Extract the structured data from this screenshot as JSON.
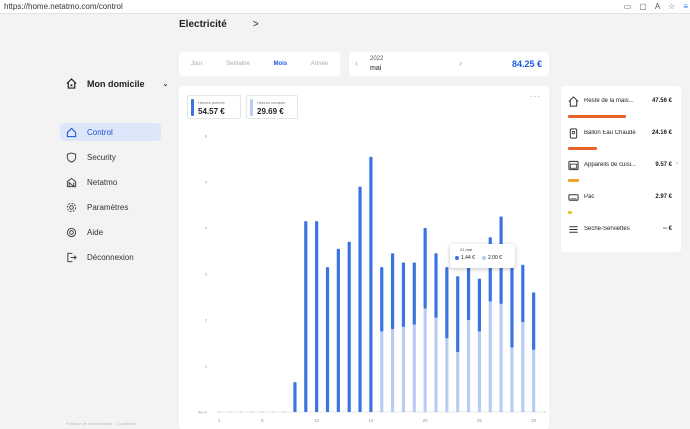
{
  "browser": {
    "url": "https://home.netatmo.com/control",
    "icons": [
      "screen-icon",
      "bookmark-icon",
      "font-icon",
      "star-icon",
      "menu-icon"
    ]
  },
  "sidebar": {
    "home_label": "Mon domicile",
    "items": [
      {
        "label": "Control",
        "icon": "home-outline-icon",
        "active": true
      },
      {
        "label": "Security",
        "icon": "shield-icon",
        "active": false
      },
      {
        "label": "Netatmo",
        "icon": "netatmo-house-icon",
        "active": false
      },
      {
        "label": "Paramètres",
        "icon": "gear-icon",
        "active": false
      },
      {
        "label": "Aide",
        "icon": "lifebuoy-icon",
        "active": false
      },
      {
        "label": "Déconnexion",
        "icon": "logout-icon",
        "active": false
      }
    ],
    "footer": [
      "Politique de confidentialité",
      "Conditions"
    ]
  },
  "header": {
    "title": "Electricité"
  },
  "tabs": [
    {
      "label": "Jour",
      "active": false
    },
    {
      "label": "Semaine",
      "active": false
    },
    {
      "label": "Mois",
      "active": true
    },
    {
      "label": "Année",
      "active": false
    }
  ],
  "period": {
    "year": "2022",
    "month": "mai",
    "total": "84.25 €"
  },
  "legend": {
    "peak": {
      "label": "Heures pleines",
      "value": "54.57 €"
    },
    "offpeak": {
      "label": "Heures creuses",
      "value": "29.69 €"
    }
  },
  "colors": {
    "peak": "#3a74e0",
    "offpeak": "#b8cdf1",
    "accent": "#1a5be0",
    "orange": "#e8622a",
    "amber": "#f0a22a",
    "yellow": "#e8c22a"
  },
  "chart_data": {
    "type": "bar",
    "stacked": true,
    "x": [
      1,
      2,
      3,
      4,
      5,
      6,
      7,
      8,
      9,
      10,
      11,
      12,
      13,
      14,
      15,
      16,
      17,
      18,
      19,
      20,
      21,
      22,
      23,
      24,
      25,
      26,
      27,
      28,
      29,
      30,
      31
    ],
    "x_tick_labels": [
      "1",
      "5",
      "10",
      "15",
      "20",
      "25",
      "30"
    ],
    "x_ticks": [
      1,
      5,
      10,
      15,
      20,
      25,
      30
    ],
    "y_tick_labels": [
      "0e+0",
      "1",
      "2",
      "3",
      "4",
      "5",
      "6"
    ],
    "ylim": [
      0,
      6
    ],
    "series": [
      {
        "name": "Heures creuses",
        "values": [
          0,
          0,
          0,
          0,
          0,
          0,
          0,
          0,
          0,
          0,
          0,
          0,
          0,
          0,
          0,
          1.75,
          1.8,
          1.85,
          1.9,
          2.25,
          2.05,
          1.6,
          1.3,
          2.0,
          1.75,
          2.4,
          2.35,
          1.4,
          1.95,
          1.35,
          0
        ]
      },
      {
        "name": "Heures pleines",
        "values": [
          0,
          0,
          0,
          0,
          0,
          0,
          0,
          0.65,
          4.15,
          4.15,
          3.15,
          3.55,
          3.7,
          4.9,
          5.55,
          1.4,
          1.65,
          1.4,
          1.35,
          1.75,
          1.4,
          1.55,
          1.65,
          1.44,
          1.15,
          1.4,
          1.9,
          1.8,
          1.25,
          1.25,
          0
        ]
      }
    ],
    "grid": false
  },
  "tooltip": {
    "day": "21 mai",
    "peak": "1.44 €",
    "offpeak": "2.00 €"
  },
  "consumers": [
    {
      "name": "Reste de la mais...",
      "amount": "47.56 €",
      "fraction": 0.58,
      "color": "#e8622a",
      "icon": "house-icon"
    },
    {
      "name": "Ballon Eau Chaude",
      "amount": "24.16 €",
      "fraction": 0.29,
      "color": "#e8622a",
      "icon": "water-heater-icon"
    },
    {
      "name": "Appareils de cuisi...",
      "amount": "9.57 €",
      "fraction": 0.11,
      "color": "#f0a22a",
      "icon": "oven-icon"
    },
    {
      "name": "Pac",
      "amount": "2.97 €",
      "fraction": 0.035,
      "color": "#e8c22a",
      "icon": "heat-pump-icon"
    },
    {
      "name": "Sèche-Serviettes",
      "amount": "-- €",
      "fraction": 0,
      "color": "#e8c22a",
      "icon": "towel-dryer-icon"
    }
  ]
}
